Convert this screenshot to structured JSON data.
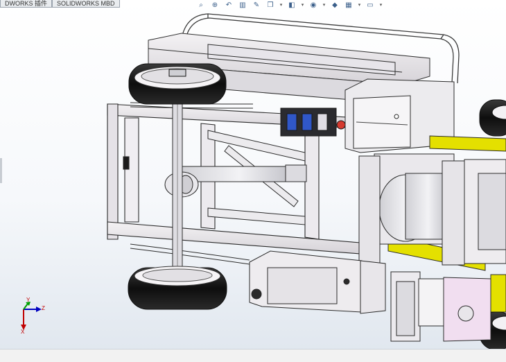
{
  "tabs": [
    "DWORKS 插件",
    "SOLIDWORKS MBD"
  ],
  "toolbar": {
    "icons": [
      "zoom-to-fit-icon",
      "zoom-area-icon",
      "previous-view-icon",
      "section-view-icon",
      "dynamic-annotation-icon",
      "view-orientation-icon",
      "display-style-icon",
      "hide-show-icon",
      "edit-appearance-icon",
      "apply-scene-icon",
      "view-settings-icon"
    ]
  },
  "triad": {
    "y_label": "Y",
    "z_label": "Z",
    "x_label": "X"
  },
  "colors": {
    "frame": "#ecebec",
    "tire": "#151515",
    "accent_yellow": "#e4e000",
    "pink_box": "#f1def0",
    "axis_red": "#c00000",
    "axis_green": "#00a000",
    "axis_blue": "#0000c0"
  }
}
